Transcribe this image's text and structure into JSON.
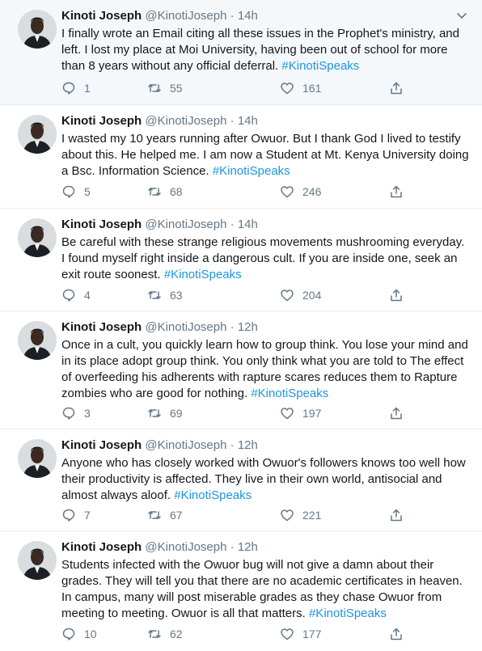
{
  "author": {
    "name": "Kinoti Joseph",
    "handle": "@KinotiJoseph"
  },
  "tweets": [
    {
      "time": "14h",
      "text": "I finally wrote an Email citing all these issues in the Prophet's ministry, and left. I lost my place at Moi University, having been out of school for more than 8 years without any official deferral.",
      "hashtag": "#KinotiSpeaks",
      "replies": "1",
      "retweets": "55",
      "likes": "161"
    },
    {
      "time": "14h",
      "text": "I wasted my 10 years running after Owuor. But I thank God I lived to testify about this. He helped me. I am now a Student at Mt. Kenya University doing a Bsc. Information Science.",
      "hashtag": "#KinotiSpeaks",
      "replies": "5",
      "retweets": "68",
      "likes": "246"
    },
    {
      "time": "14h",
      "text": "Be careful with these strange religious movements mushrooming everyday. I found myself right inside a dangerous cult. If you are inside one, seek an exit route soonest.",
      "hashtag": "#KinotiSpeaks",
      "replies": "4",
      "retweets": "63",
      "likes": "204"
    },
    {
      "time": "12h",
      "text": "Once in a cult, you quickly learn how to group think. You lose your mind and in its place adopt group think. You only think what you are told to The effect of overfeeding his adherents with rapture scares reduces them to Rapture zombies who are good for nothing.",
      "hashtag": "#KinotiSpeaks",
      "replies": "3",
      "retweets": "69",
      "likes": "197"
    },
    {
      "time": "12h",
      "text": "Anyone who has closely worked with Owuor's followers knows too well how their productivity is affected. They live in their own world, antisocial and almost always aloof.",
      "hashtag": "#KinotiSpeaks",
      "replies": "7",
      "retweets": "67",
      "likes": "221"
    },
    {
      "time": "12h",
      "text": "Students infected with the Owuor bug will not give a damn about their grades. They will tell you that there are no academic certificates in heaven. In campus, many will post miserable grades as they chase Owuor from meeting to meeting. Owuor is all that matters.",
      "hashtag": "#KinotiSpeaks",
      "replies": "10",
      "retweets": "62",
      "likes": "177"
    }
  ]
}
